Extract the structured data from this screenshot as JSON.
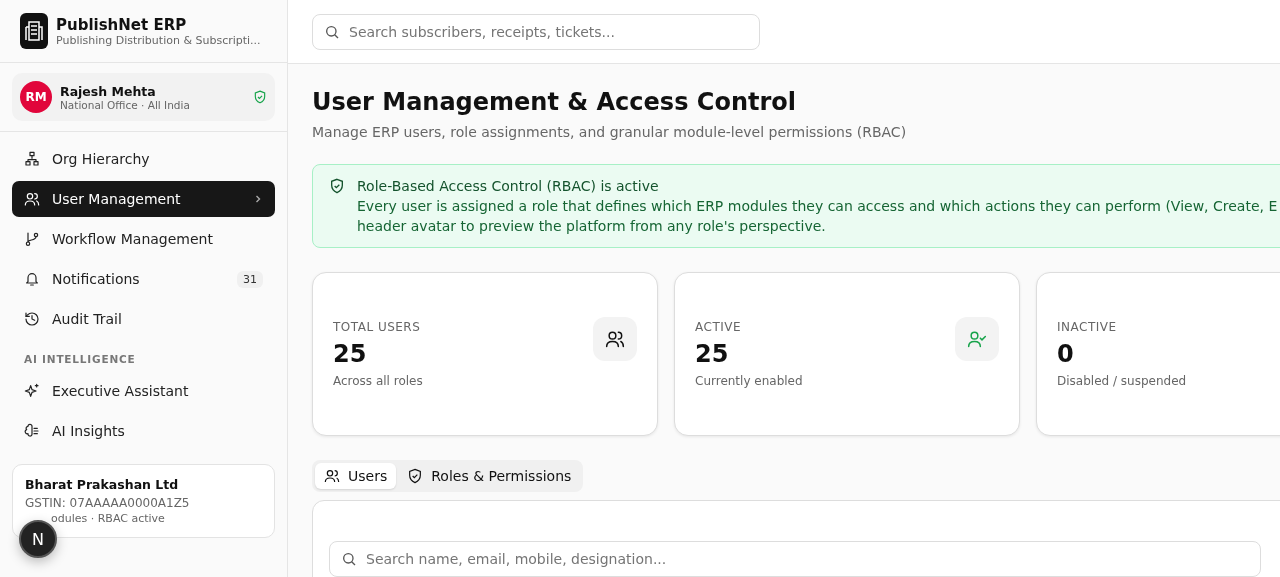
{
  "brand": {
    "name": "PublishNet ERP",
    "tagline": "Publishing Distribution & Subscripti..."
  },
  "user": {
    "initials": "RM",
    "name": "Rajesh Mehta",
    "office": "National Office · All India"
  },
  "nav": [
    {
      "kind": "item",
      "label": "Org Hierarchy",
      "selected": false
    },
    {
      "kind": "item",
      "label": "User Management",
      "selected": true
    },
    {
      "kind": "item",
      "label": "Workflow Management",
      "selected": false
    },
    {
      "kind": "item",
      "label": "Notifications",
      "badge": "31",
      "selected": false
    },
    {
      "kind": "item",
      "label": "Audit Trail",
      "selected": false
    },
    {
      "kind": "section",
      "label": "AI INTELLIGENCE"
    },
    {
      "kind": "item",
      "label": "Executive Assistant",
      "selected": false
    },
    {
      "kind": "item",
      "label": "AI Insights",
      "selected": false
    }
  ],
  "company": {
    "name": "Bharat Prakashan Ltd",
    "gstin": "GSTIN: 07AAAAA0000A1Z5",
    "meta": "odules · RBAC active"
  },
  "floating_badge": "N",
  "search": {
    "placeholder": "Search subscribers, receipts, tickets..."
  },
  "page": {
    "title": "User Management & Access Control",
    "subtitle": "Manage ERP users, role assignments, and granular module-level permissions (RBAC)"
  },
  "alert": {
    "title": "Role-Based Access Control (RBAC) is active",
    "lines": [
      "Every user is assigned a role that defines which ERP modules they can access and which actions they can perform (View, Create, E",
      "header avatar to preview the platform from any role's perspective."
    ]
  },
  "stats": [
    {
      "label": "TOTAL USERS",
      "value": "25",
      "note": "Across all roles"
    },
    {
      "label": "ACTIVE",
      "value": "25",
      "note": "Currently enabled"
    },
    {
      "label": "INACTIVE",
      "value": "0",
      "note": "Disabled / suspended"
    }
  ],
  "tabs": [
    {
      "label": "Users",
      "selected": true
    },
    {
      "label": "Roles & Permissions",
      "selected": false
    }
  ],
  "user_search": {
    "placeholder": "Search name, email, mobile, designation..."
  }
}
